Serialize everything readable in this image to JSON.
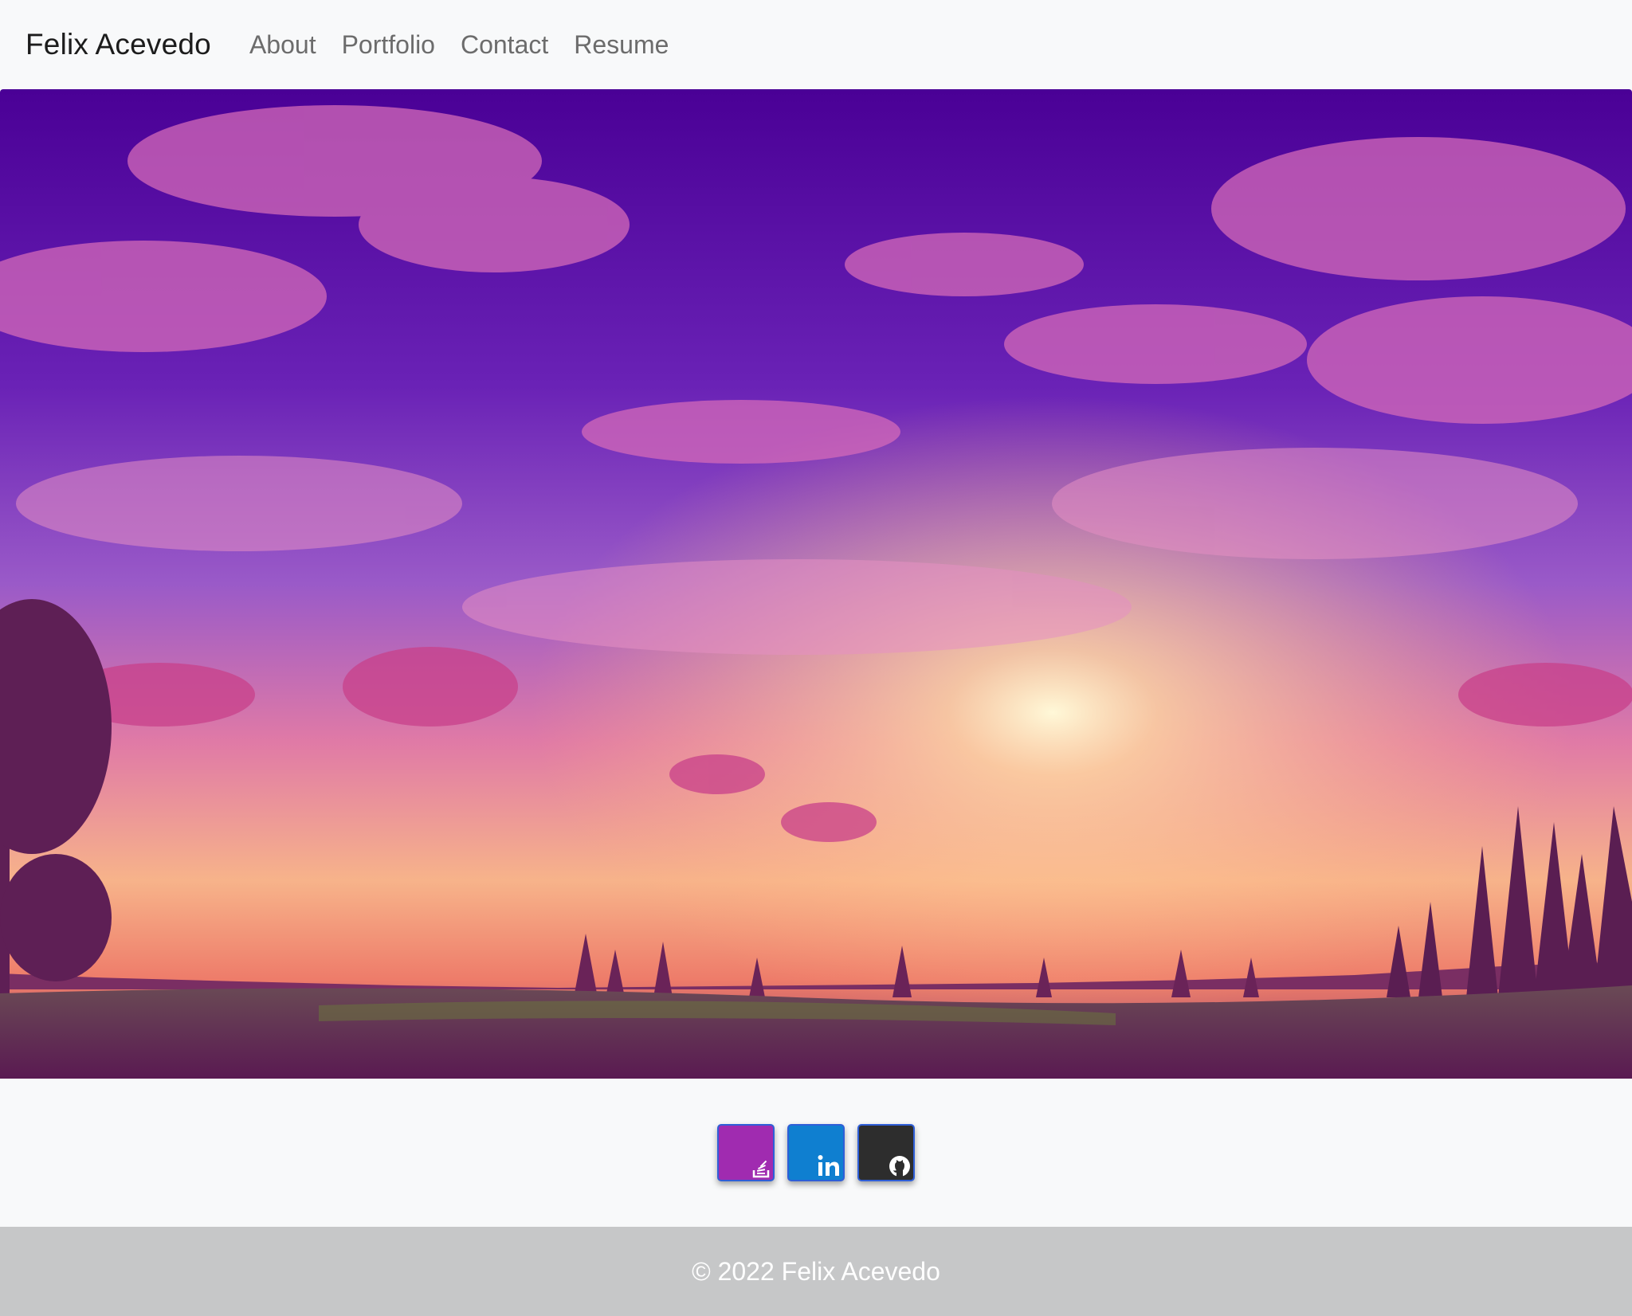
{
  "navbar": {
    "brand": "Felix Acevedo",
    "links": [
      "About",
      "Portfolio",
      "Contact",
      "Resume"
    ]
  },
  "hero": {
    "image": "sunset-landscape-illustration"
  },
  "social": {
    "icons": [
      "stackoverflow-icon",
      "linkedin-icon",
      "github-icon"
    ],
    "colors": {
      "stackoverflow": "#a02bb0",
      "linkedin": "#0f7fd0",
      "github": "#2d2d2d"
    }
  },
  "footer": {
    "copyright": "© 2022 Felix Acevedo",
    "background": "#c6c7c8"
  }
}
